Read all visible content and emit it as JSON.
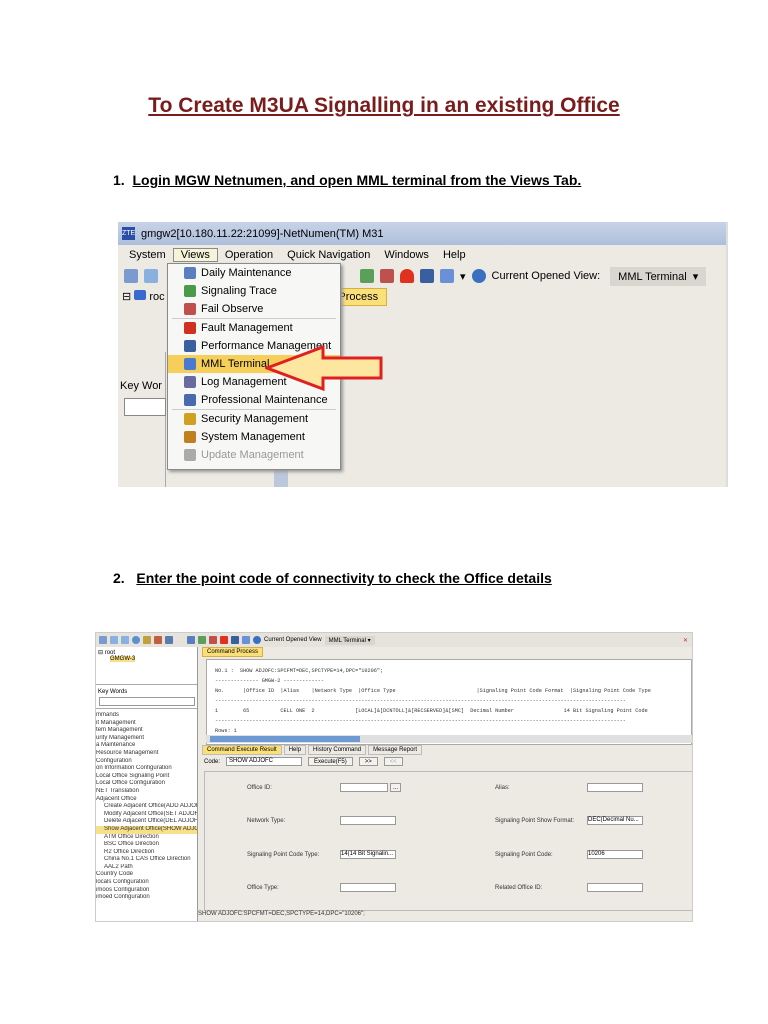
{
  "title": "To Create M3UA Signalling in an existing Office",
  "steps": [
    {
      "num": "1.",
      "text": "Login MGW Netnumen, and open MML terminal from the Views Tab."
    },
    {
      "num": "2.",
      "text": "Enter the point code of connectivity to check the Office details"
    }
  ],
  "shot1": {
    "window_title": "gmgw2[10.180.11.22:21099]-NetNumen(TM) M31",
    "menus": [
      "System",
      "Views",
      "Operation",
      "Quick Navigation",
      "Windows",
      "Help"
    ],
    "current_view_label": "Current Opened View:",
    "current_view": "MML Terminal",
    "tab": "and Process",
    "tree_root": "roc",
    "key_words": "Key Wor",
    "views_menu": [
      {
        "label": "Daily Maintenance",
        "color": "#5a7fc0"
      },
      {
        "label": "Signaling Trace",
        "color": "#4a9a4a"
      },
      {
        "label": "Fail Observe",
        "color": "#c0504d"
      },
      {
        "label": "Fault Management",
        "color": "#d03020"
      },
      {
        "label": "Performance Management",
        "color": "#3a5fa0"
      },
      {
        "label": "MML Terminal",
        "color": "#4a7ad0",
        "selected": true
      },
      {
        "label": "Log Management",
        "color": "#6a6aa0"
      },
      {
        "label": "Professional Maintenance",
        "color": "#4a6ab0"
      },
      {
        "label": "Security Management",
        "color": "#d0a020"
      },
      {
        "label": "System Management",
        "color": "#c08020"
      },
      {
        "label": "Update Management",
        "color": "#aaaaaa",
        "disabled": true
      }
    ]
  },
  "shot2": {
    "current_view_label": "Current Opened View",
    "current_view": "MML Terminal",
    "tree_root": "root",
    "tree_child": "GMGW-3",
    "key_words": "Key Words",
    "command_tab": "Command Process",
    "nav_items": [
      "mmands",
      "it Management",
      "tem Management",
      "urity Management",
      "a Maintenance",
      "Resource Management",
      "Configuration",
      "on Information Configuration",
      "Local Office Signaling Point",
      "Local Office Configuration",
      "NET Translation",
      "Adjacent Office",
      "Create Adjacent Office(ADD ADJOFC)",
      "Modify Adjacent Office(SET ADJOFC)",
      "Delete Adjacent Office(DEL ADJOFC)",
      "Show Adjacent Office(SHOW ADJOFC)",
      "ATM Office Direction",
      "BSC Office Direction",
      "R2 Office Direction",
      "China No.1 CAS Office Direction",
      "AAL2 Path",
      "Country Code",
      "locals Configuration",
      "imoos Configuration",
      "imoed Configuration"
    ],
    "console": "NO.1 :  SHOW ADJOFC:SPCFMT=DEC,SPCTYPE=14,DPC=\"10206\";\n-------------- GMGW-2 -------------\nNo.      |Office ID  |Alias    |Network Type  |Office Type                          |Signaling Point Code Format  |Signaling Point Code Type\n------------------------------------------------------------------------------------------------------------------------------------\n1        65          CELL ONE  2             [LOCAL]&[DCNTOLL]&[RECSERVED]&[SMC]  Decimal Number                14 Bit Signaling Point Code\n------------------------------------------------------------------------------------------------------------------------------------\nRows: 1",
    "bottom_tabs": [
      "Command Execute Result",
      "Help",
      "History Command",
      "Message Report"
    ],
    "code_label": "Code:",
    "code_value": "SHOW ADJOFC",
    "execute": "Execute(F5)",
    "next": ">>",
    "prev": "<<",
    "fields": {
      "office_id": "Office ID:",
      "alias": "Alias:",
      "network_type": "Network Type:",
      "sp_show_format": "Signaling Point Show Format:",
      "sp_show_format_value": "DEC(Decimal Nu...",
      "spc_type": "Signaling Point Code Type:",
      "spc_type_value": "14(14 Bit Signalin...",
      "spc": "Signaling Point Code:",
      "spc_value": "10206",
      "office_type": "Office Type:",
      "related_office_id": "Related Office ID:"
    },
    "command_line": "SHOW ADJOFC:SPCFMT=DEC,SPCTYPE=14,DPC=\"10206\";"
  }
}
